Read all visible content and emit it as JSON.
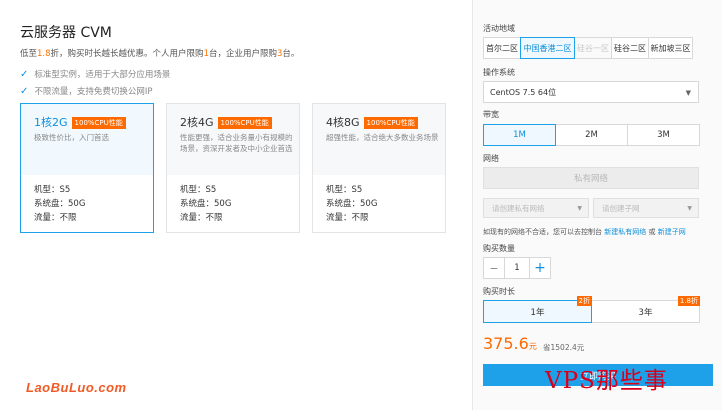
{
  "product": {
    "title": "云服务器 CVM",
    "intro_prefix": "低至",
    "intro_discount": "1.8",
    "intro_mid": "折，购买时长越长越优惠。个人用户限购",
    "intro_personal": "1",
    "intro_mid2": "台，企业用户限购",
    "intro_enterprise": "3",
    "intro_suffix": "台。",
    "features": [
      "标准型实例，适用于大部分应用场景",
      "不限流量，支持免费切换公网IP"
    ]
  },
  "cards": [
    {
      "name": "1核2G",
      "badge": "100%CPU性能",
      "desc": "极致性价比，入门首选",
      "spec_model": "机型：S5",
      "spec_disk": "系统盘：50G",
      "spec_traffic": "流量：不限",
      "selected": true
    },
    {
      "name": "2核4G",
      "badge": "100%CPU性能",
      "desc": "性能更强，适合业务量小有规模的场景，资深开发者及中小企业首选",
      "spec_model": "机型：S5",
      "spec_disk": "系统盘：50G",
      "spec_traffic": "流量：不限",
      "selected": false
    },
    {
      "name": "4核8G",
      "badge": "100%CPU性能",
      "desc": "超强性能，适合绝大多数业务场景",
      "spec_model": "机型：S5",
      "spec_disk": "系统盘：50G",
      "spec_traffic": "流量：不限",
      "selected": false
    }
  ],
  "config": {
    "region_label": "活动地域",
    "regions": [
      {
        "label": "首尔二区",
        "state": "normal"
      },
      {
        "label": "中国香港二区",
        "state": "selected"
      },
      {
        "label": "硅谷一区",
        "state": "disabled"
      },
      {
        "label": "硅谷二区",
        "state": "normal"
      },
      {
        "label": "新加坡三区",
        "state": "normal"
      }
    ],
    "os_label": "操作系统",
    "os_value": "CentOS 7.5 64位",
    "bandwidth_label": "带宽",
    "bandwidth": [
      "1M",
      "2M",
      "3M"
    ],
    "bandwidth_selected": "1M",
    "network_label": "网络",
    "vpc_button": "私有网络",
    "vpc_placeholder": "请创建私有网络",
    "subnet_placeholder": "请创建子网",
    "network_note": "如现有的网络不合适，您可以去控制台",
    "network_link_vpc": "新建私有网络",
    "network_note_or": "或",
    "network_link_subnet": "新建子网",
    "quantity_label": "购买数量",
    "quantity": "1",
    "minus": "−",
    "plus": "+",
    "duration_label": "购买时长",
    "durations": [
      {
        "label": "1年",
        "tag": "2折",
        "selected": true
      },
      {
        "label": "3年",
        "tag": "1.8折",
        "selected": false
      }
    ],
    "price": "375.6",
    "price_unit": "元",
    "save_text": "省1502.4元",
    "buy_button": "立即购买"
  },
  "watermarks": {
    "left": "LaoBuLuo.com",
    "right": "VPS那些事"
  },
  "colors": {
    "accent": "#1da1e9",
    "orange": "#ff6a00",
    "watermark_red": "#d6001c"
  }
}
